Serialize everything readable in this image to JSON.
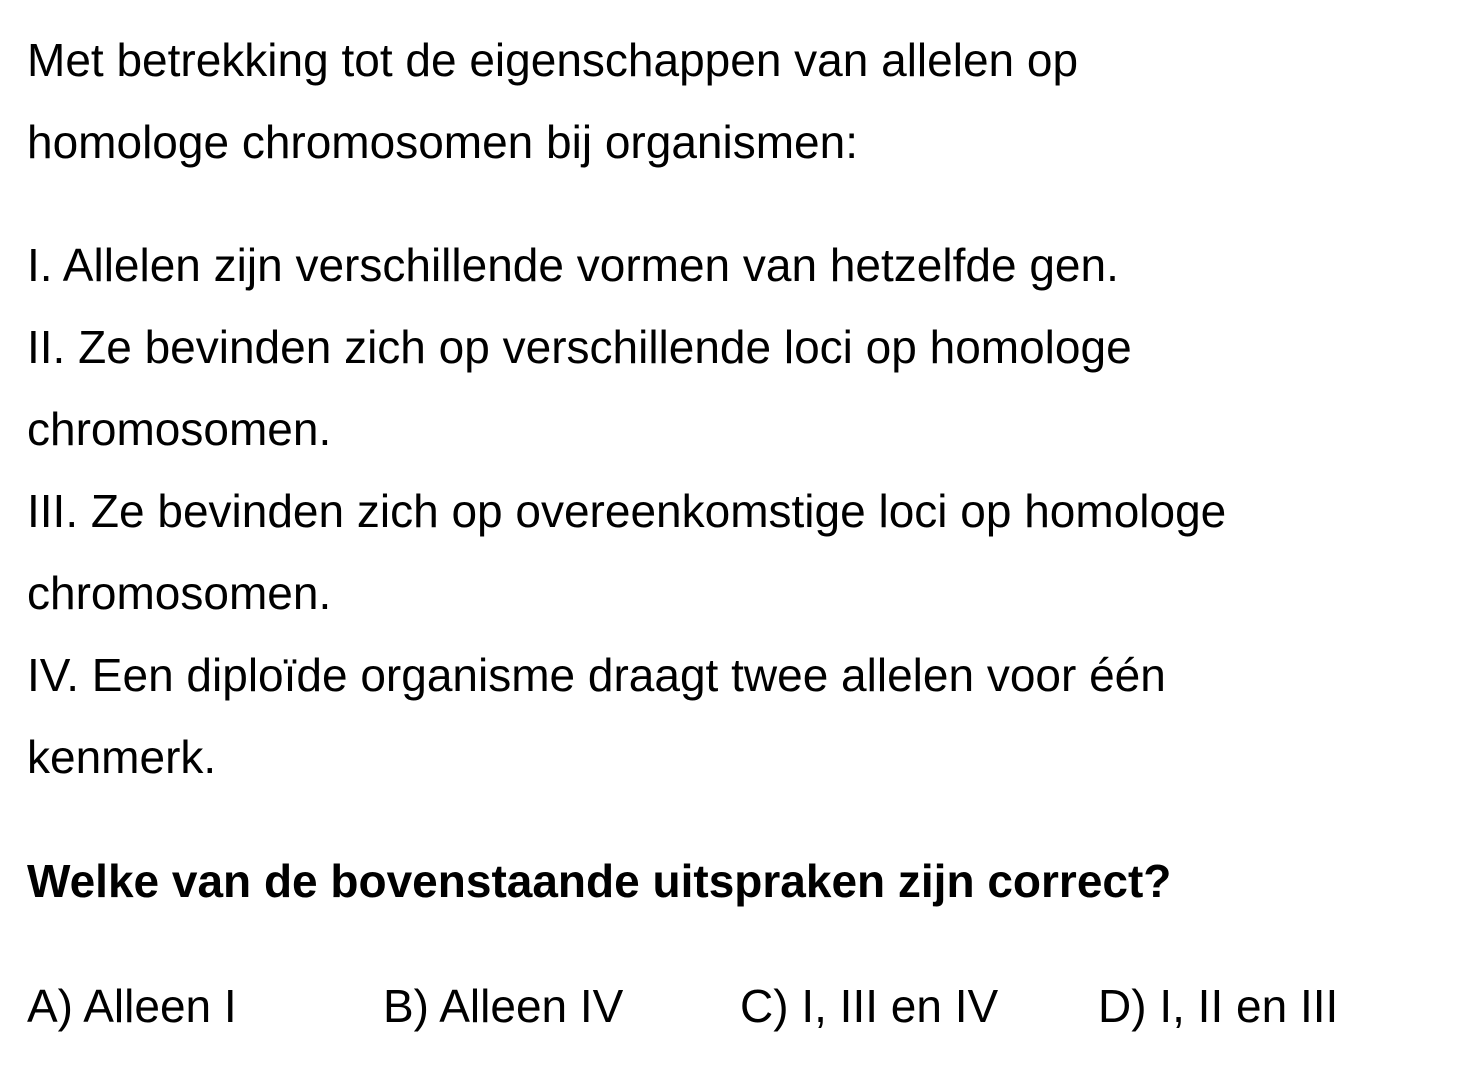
{
  "question": {
    "intro_lines": [
      "Met betrekking tot de eigenschappen van allelen op",
      "homologe chromosomen bij organismen:"
    ],
    "statements": [
      "I. Allelen zijn verschillende vormen van hetzelfde gen.",
      "II. Ze bevinden zich op verschillende loci op homologe",
      "chromosomen.",
      "III. Ze bevinden zich op overeenkomstige loci op homologe",
      "chromosomen.",
      "IV. Een diploïde organisme draagt twee allelen voor één",
      "kenmerk."
    ],
    "prompt": "Welke van de bovenstaande uitspraken zijn correct?",
    "options": [
      "A) Alleen I",
      "B) Alleen IV",
      "C) I, III en IV",
      "D) I, II en III"
    ]
  }
}
